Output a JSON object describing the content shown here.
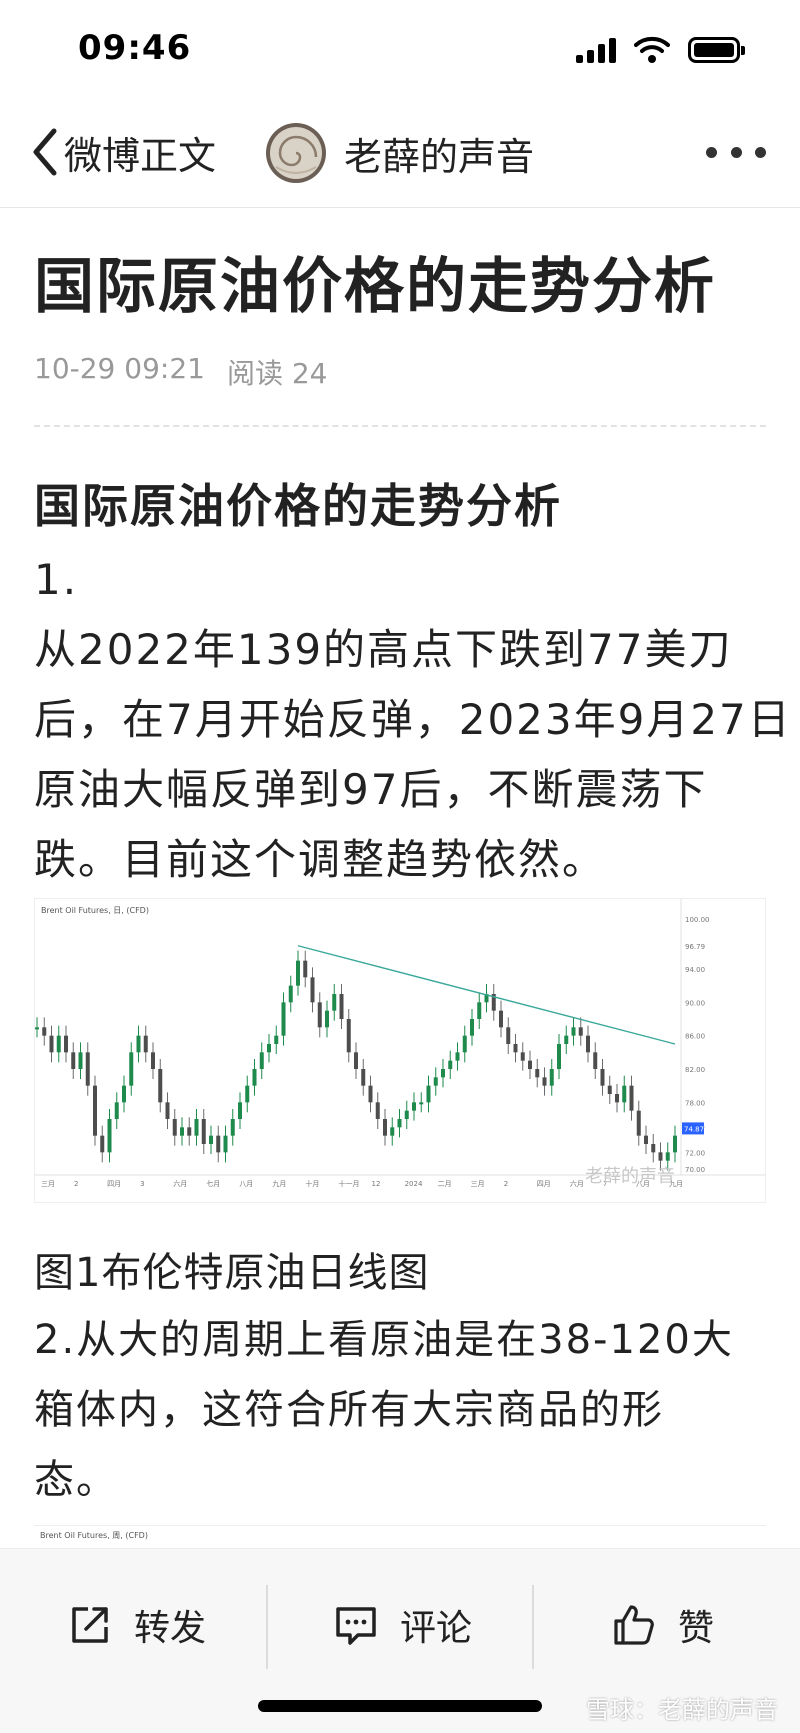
{
  "status": {
    "time": "09:46"
  },
  "nav": {
    "back_label": "微博正文",
    "author_name": "老薛的声音"
  },
  "article": {
    "title": "国际原油价格的走势分析",
    "date": "10-29 09:21",
    "reads": "阅读 24",
    "subheading": "国际原油价格的走势分析",
    "point1_lines": [
      "1.",
      "从2022年139的高点下跌到77美刀",
      "后，在7月开始反弹，2023年9月27日",
      "原油大幅反弹到97后，不断震荡下",
      "跌。目前这个调整趋势依然。"
    ],
    "chart1_label": "Brent Oil Futures, 日, (CFD)",
    "image_watermark": "老薛的声音",
    "caption1": "图1布伦特原油日线图",
    "point2_lines": [
      "2.从大的周期上看原油是在38-120大",
      "箱体内，这符合所有大宗商品的形",
      "态。"
    ],
    "chart2_label": "Brent Oil Futures, 周, (CFD)"
  },
  "chart_data": {
    "type": "line",
    "title": "Brent Oil Futures, 日, (CFD)",
    "y_axis_labels": [
      "100.00",
      "96.79",
      "94.00",
      "90.00",
      "86.00",
      "82.00",
      "78.00",
      "74.87",
      "72.00",
      "70.00"
    ],
    "x_axis_labels": [
      "三月",
      "2",
      "四月",
      "3",
      "六月",
      "七月",
      "八月",
      "九月",
      "十月",
      "十一月",
      "12",
      "2024",
      "二月",
      "三月",
      "2",
      "四月",
      "六月",
      "7",
      "八月",
      "九月"
    ],
    "series": [
      {
        "values": [
          87,
          86,
          84,
          86,
          84,
          82,
          84,
          80,
          74,
          72,
          76,
          78,
          80,
          84,
          86,
          84,
          82,
          78,
          76,
          74,
          75,
          74,
          76,
          73,
          74,
          72,
          74,
          76,
          78,
          80,
          82,
          84,
          85,
          86,
          90,
          92,
          95,
          93,
          90,
          87,
          89,
          91,
          88,
          84,
          82,
          80,
          78,
          76,
          74,
          75,
          76,
          77,
          78,
          78,
          80,
          81,
          82,
          83,
          84,
          86,
          88,
          90,
          91,
          89,
          87,
          85,
          84,
          83,
          82,
          81,
          80,
          82,
          85,
          86,
          87,
          86,
          84,
          82,
          80,
          79,
          78,
          80,
          77,
          74,
          73,
          72,
          71,
          72,
          74
        ]
      }
    ],
    "trendline": {
      "from": 96.79,
      "to": 85
    },
    "last_price": 74.87
  },
  "footer": {
    "watermark": "雪球：老薛的声音"
  },
  "actions": {
    "repost": "转发",
    "comment": "评论",
    "like": "赞"
  }
}
